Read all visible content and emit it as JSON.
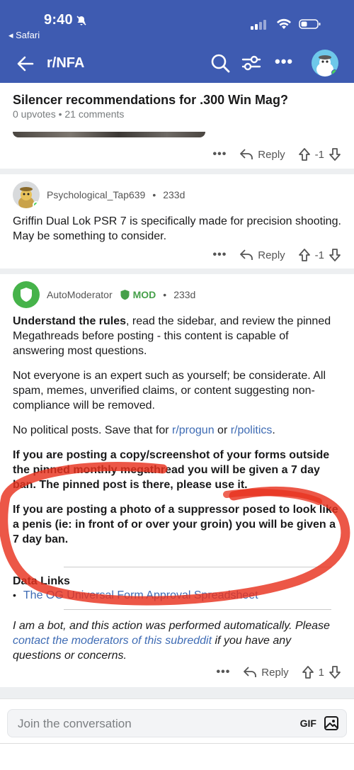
{
  "status_bar": {
    "time": "9:40",
    "back_app": "◂ Safari"
  },
  "nav": {
    "subreddit": "r/NFA",
    "icons": [
      "back-arrow-icon",
      "search-icon",
      "filter-icon",
      "more-icon",
      "avatar"
    ]
  },
  "post": {
    "title": "Silencer recommendations for .300 Win Mag?",
    "meta": "0 upvotes • 21 comments"
  },
  "actions": {
    "more": "•••",
    "reply": "Reply",
    "score": "-1"
  },
  "comments": [
    {
      "author": "Psychological_Tap639",
      "age": "233d",
      "body": "Griffin Dual Lok PSR 7 is specifically made for precision shooting. May be something to consider.",
      "score": "-1",
      "reply": "Reply"
    },
    {
      "author": "AutoModerator",
      "badge": "MOD",
      "age": "233d",
      "p1_bold": "Understand the rules",
      "p1_rest": ", read the sidebar, and review the pinned Megathreads before posting - this content is capable of answering most questions.",
      "p2": "Not everyone is an expert such as yourself; be considerate. All spam, memes, unverified claims, or content suggesting non-compliance will be removed.",
      "p3_pre": "No political posts. Save that for ",
      "p3_link1": "r/progun",
      "p3_mid": " or ",
      "p3_link2": "r/politics",
      "p3_end": ".",
      "p4": "If you are posting a copy/screenshot of your forms outside the pinned monthly megathread you will be given a 7 day ban. The pinned post is there, please use it.",
      "p5": "If you are posting a photo of a suppressor posed to look like a penis (ie: in front of or over your groin) you will be given a 7 day ban.",
      "data_links_title": "Data Links",
      "data_link_bullet": "•",
      "data_link_1": "The OG Universal Form Approval Spreadsheet",
      "bot_pre": "I am a bot, and this action was performed automatically. Please ",
      "bot_link": "contact the moderators of this subreddit",
      "bot_post": " if you have any questions or concerns.",
      "score": "1",
      "reply": "Reply"
    }
  ],
  "composer": {
    "placeholder": "Join the conversation",
    "gif": "GIF"
  },
  "colors": {
    "header": "#3e5bb1",
    "link": "#3e6bb4",
    "mod_green": "#46a04a",
    "annotation": "#e8321e"
  }
}
